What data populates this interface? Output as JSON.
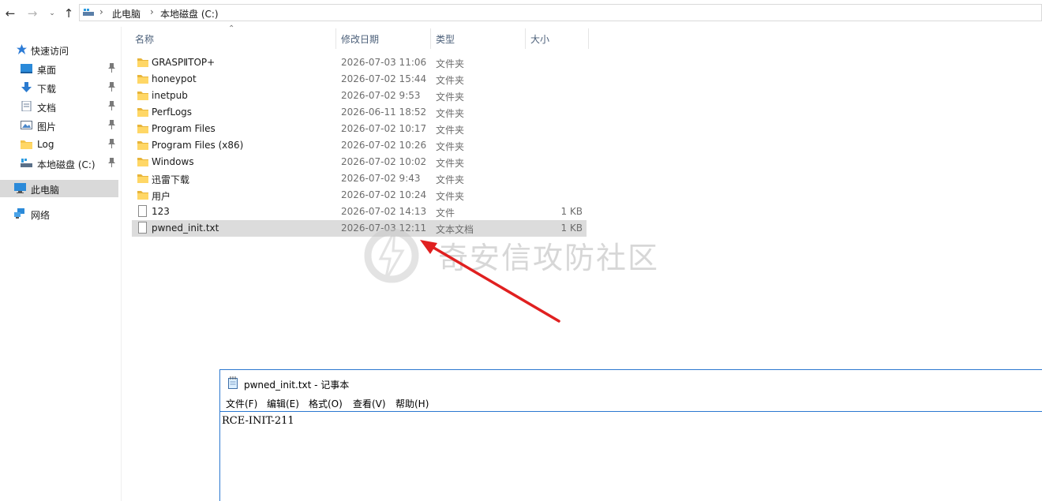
{
  "breadcrumb": {
    "root_icon": "this-pc-icon",
    "items": [
      "此电脑",
      "本地磁盘 (C:)"
    ]
  },
  "sidebar": {
    "quick_access": "快速访问",
    "items": [
      {
        "label": "桌面",
        "icon": "desktop-icon",
        "pinned": true
      },
      {
        "label": "下载",
        "icon": "download-icon",
        "pinned": true
      },
      {
        "label": "文档",
        "icon": "document-icon",
        "pinned": true
      },
      {
        "label": "图片",
        "icon": "picture-icon",
        "pinned": true
      },
      {
        "label": "Log",
        "icon": "folder-icon",
        "pinned": true
      },
      {
        "label": "本地磁盘 (C:)",
        "icon": "drive-icon",
        "pinned": true
      }
    ],
    "this_pc": "此电脑",
    "network": "网络"
  },
  "columns": {
    "name": "名称",
    "date": "修改日期",
    "type": "类型",
    "size": "大小"
  },
  "files": [
    {
      "name": "GRASPⅡTOP+",
      "date": "2026-07-03 11:06",
      "type": "文件夹",
      "size": "",
      "icon": "folder-icon"
    },
    {
      "name": "honeypot",
      "date": "2026-07-02 15:44",
      "type": "文件夹",
      "size": "",
      "icon": "folder-icon"
    },
    {
      "name": "inetpub",
      "date": "2026-07-02 9:53",
      "type": "文件夹",
      "size": "",
      "icon": "folder-icon"
    },
    {
      "name": "PerfLogs",
      "date": "2026-06-11 18:52",
      "type": "文件夹",
      "size": "",
      "icon": "folder-icon"
    },
    {
      "name": "Program Files",
      "date": "2026-07-02 10:17",
      "type": "文件夹",
      "size": "",
      "icon": "folder-icon"
    },
    {
      "name": "Program Files (x86)",
      "date": "2026-07-02 10:26",
      "type": "文件夹",
      "size": "",
      "icon": "folder-icon"
    },
    {
      "name": "Windows",
      "date": "2026-07-02 10:02",
      "type": "文件夹",
      "size": "",
      "icon": "folder-icon"
    },
    {
      "name": "迅雷下载",
      "date": "2026-07-02 9:43",
      "type": "文件夹",
      "size": "",
      "icon": "folder-icon"
    },
    {
      "name": "用户",
      "date": "2026-07-02 10:24",
      "type": "文件夹",
      "size": "",
      "icon": "folder-icon"
    },
    {
      "name": "123",
      "date": "2026-07-02 14:13",
      "type": "文件",
      "size": "1 KB",
      "icon": "file-icon"
    },
    {
      "name": "pwned_init.txt",
      "date": "2026-07-03 12:11",
      "type": "文本文档",
      "size": "1 KB",
      "icon": "text-file-icon",
      "highlighted": true
    }
  ],
  "watermark": {
    "text": "奇安信攻防社区"
  },
  "annotation_arrow": {
    "color": "#e02020"
  },
  "notepad": {
    "title": "pwned_init.txt - 记事本",
    "menu": [
      "文件(F)",
      "编辑(E)",
      "格式(O)",
      "查看(V)",
      "帮助(H)"
    ],
    "content": "RCE-INIT-211"
  }
}
